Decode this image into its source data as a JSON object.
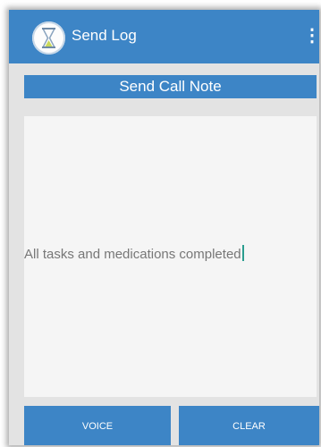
{
  "appbar": {
    "title": "Send Log",
    "menu_icon": "more-vert-icon",
    "app_icon": "hourglass-icon"
  },
  "section": {
    "title": "Send Call Note"
  },
  "note": {
    "value": "All tasks and medications completed"
  },
  "buttons": {
    "voice_label": "VOICE",
    "clear_label": "CLEAR"
  },
  "colors": {
    "primary": "#3d85c6",
    "background": "#e3e3e3",
    "input_background": "#f5f5f5",
    "caret": "#2a9d8f"
  }
}
